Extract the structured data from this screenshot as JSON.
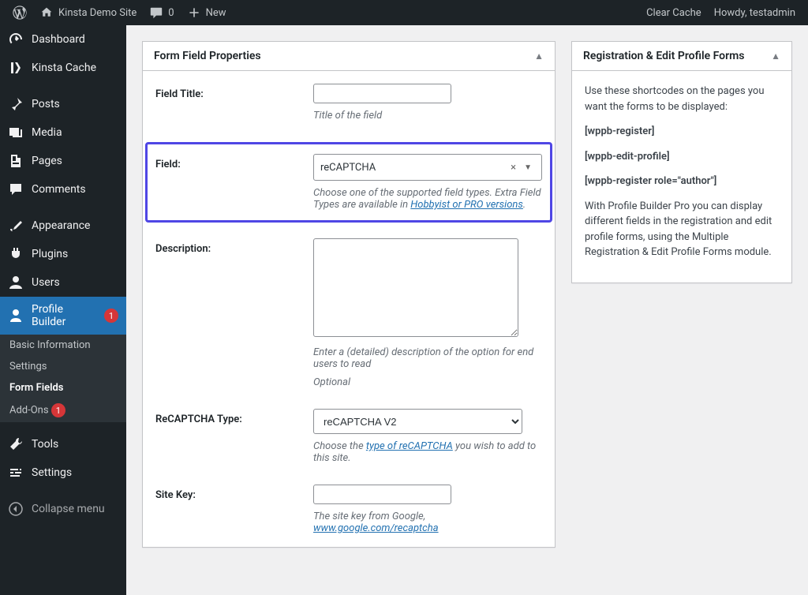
{
  "adminbar": {
    "site_title": "Kinsta Demo Site",
    "comments_count": "0",
    "new_label": "New",
    "clear_cache": "Clear Cache",
    "howdy": "Howdy, testadmin"
  },
  "sidebar": {
    "items": [
      {
        "label": "Dashboard",
        "icon": "dashboard"
      },
      {
        "label": "Kinsta Cache",
        "icon": "kinsta"
      },
      {
        "label": "Posts",
        "icon": "pin"
      },
      {
        "label": "Media",
        "icon": "media"
      },
      {
        "label": "Pages",
        "icon": "pages"
      },
      {
        "label": "Comments",
        "icon": "comment"
      },
      {
        "label": "Appearance",
        "icon": "appearance"
      },
      {
        "label": "Plugins",
        "icon": "plugins"
      },
      {
        "label": "Users",
        "icon": "users"
      },
      {
        "label": "Profile Builder",
        "icon": "profile",
        "badge": "1"
      },
      {
        "label": "Tools",
        "icon": "tools"
      },
      {
        "label": "Settings",
        "icon": "settings"
      },
      {
        "label": "Collapse menu",
        "icon": "collapse"
      }
    ],
    "submenu": [
      {
        "label": "Basic Information"
      },
      {
        "label": "Settings"
      },
      {
        "label": "Form Fields",
        "current": true
      },
      {
        "label": "Add-Ons",
        "badge": "1"
      }
    ]
  },
  "panel": {
    "header": "Form Field Properties",
    "rows": {
      "field_title": {
        "label": "Field Title:",
        "value": "",
        "helper": "Title of the field"
      },
      "field": {
        "label": "Field:",
        "value": "reCAPTCHA",
        "helper_pre": "Choose one of the supported field types. Extra Field Types are available in ",
        "helper_link": "Hobbyist or PRO versions",
        "helper_post": "."
      },
      "description": {
        "label": "Description:",
        "value": "",
        "helper1": "Enter a (detailed) description of the option for end users to read",
        "helper2": "Optional"
      },
      "recaptcha_type": {
        "label": "ReCAPTCHA Type:",
        "value": "reCAPTCHA V2",
        "helper_pre": "Choose the ",
        "helper_link": "type of reCAPTCHA",
        "helper_post": " you wish to add to this site."
      },
      "site_key": {
        "label": "Site Key:",
        "value": "",
        "helper_pre": "The site key from Google, ",
        "helper_link": "www.google.com/recaptcha"
      }
    }
  },
  "sidebox": {
    "header": "Registration & Edit Profile Forms",
    "intro": "Use these shortcodes on the pages you want the forms to be displayed:",
    "shortcodes": [
      "[wppb-register]",
      "[wppb-edit-profile]",
      "[wppb-register role=\"author\"]"
    ],
    "note": "With Profile Builder Pro you can display different fields in the registration and edit profile forms, using the Multiple Registration & Edit Profile Forms module."
  }
}
